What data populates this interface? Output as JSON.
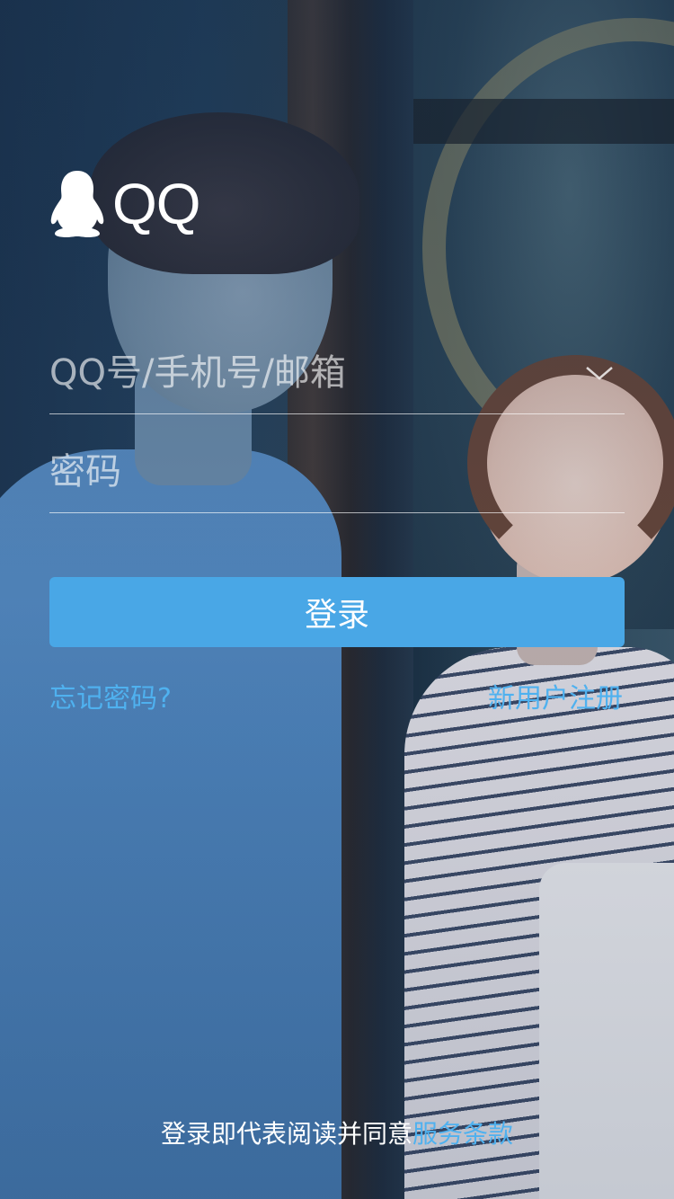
{
  "brand": {
    "logo_text": "QQ",
    "icon": "penguin-icon"
  },
  "login_form": {
    "account_placeholder": "QQ号/手机号/邮箱",
    "account_value": "",
    "password_placeholder": "密码",
    "password_value": "",
    "dropdown_icon": "chevron-down-icon",
    "login_label": "登录",
    "forgot_label": "忘记密码?",
    "register_label": "新用户注册"
  },
  "footer": {
    "agreement_prefix": "登录即代表阅读并同意",
    "terms_label": "服务条款"
  },
  "colors": {
    "accent": "#49a7e6",
    "link": "#4fb1ef",
    "text_light": "#ffffff"
  }
}
